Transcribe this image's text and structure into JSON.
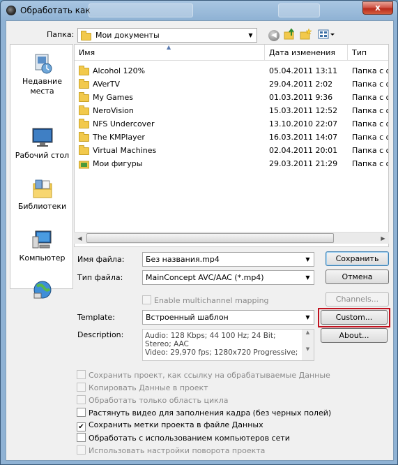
{
  "window": {
    "title": "Обработать как",
    "close": "x"
  },
  "look_in": {
    "label": "Папка:",
    "value": "Мои документы"
  },
  "places": [
    {
      "label": "Недавние места"
    },
    {
      "label": "Рабочий стол"
    },
    {
      "label": "Библиотеки"
    },
    {
      "label": "Компьютер"
    },
    {
      "label": ""
    }
  ],
  "columns": {
    "name": "Имя",
    "date": "Дата изменения",
    "type": "Тип"
  },
  "files": [
    {
      "name": "Alcohol 120%",
      "date": "05.04.2011 13:11",
      "type": "Папка с ф"
    },
    {
      "name": "AVerTV",
      "date": "29.04.2011 2:02",
      "type": "Папка с ф"
    },
    {
      "name": "My Games",
      "date": "01.03.2011 9:36",
      "type": "Папка с ф"
    },
    {
      "name": "NeroVision",
      "date": "15.03.2011 12:52",
      "type": "Папка с ф"
    },
    {
      "name": "NFS Undercover",
      "date": "13.10.2010 22:07",
      "type": "Папка с ф"
    },
    {
      "name": "The KMPlayer",
      "date": "16.03.2011 14:07",
      "type": "Папка с ф"
    },
    {
      "name": "Virtual Machines",
      "date": "02.04.2011 20:01",
      "type": "Папка с ф"
    },
    {
      "name": "Мои фигуры",
      "date": "29.03.2011 21:29",
      "type": "Папка с ф"
    }
  ],
  "filename": {
    "label": "Имя файла:",
    "value": "Без названия.mp4"
  },
  "filetype": {
    "label": "Тип файла:",
    "value": "MainConcept AVC/AAC (*.mp4)"
  },
  "multichannel": {
    "label": "Enable multichannel mapping"
  },
  "template": {
    "label": "Template:",
    "value": "Встроенный шаблон"
  },
  "description": {
    "label": "Description:",
    "text": "Audio: 128 Kbps; 44 100 Hz; 24 Bit; Stereo; AAC\nVideo: 29,970 fps; 1280x720 Progressive;"
  },
  "buttons": {
    "save": "Сохранить",
    "cancel": "Отмена",
    "channels": "Channels...",
    "custom": "Custom...",
    "about": "About..."
  },
  "options": [
    {
      "label": "Сохранить проект, как ссылку на обрабатываемые Данные",
      "checked": false,
      "enabled": false
    },
    {
      "label": "Копировать Данные в проект",
      "checked": false,
      "enabled": false
    },
    {
      "label": "Обработать только область цикла",
      "checked": false,
      "enabled": false
    },
    {
      "label": "Растянуть видео для заполнения кадра (без черных полей)",
      "checked": false,
      "enabled": true
    },
    {
      "label": "Сохранить метки проекта в файле Данных",
      "checked": true,
      "enabled": true
    },
    {
      "label": "Обработать с использованием компьютеров сети",
      "checked": false,
      "enabled": true
    },
    {
      "label": "Использовать настройки поворота проекта",
      "checked": false,
      "enabled": false
    }
  ],
  "colors": {
    "highlight": "#c0121f",
    "folder": "#f2c94c",
    "titlebar": "#a9c6e2"
  },
  "icons": [
    "back-arrow-icon",
    "up-folder-icon",
    "new-folder-icon",
    "view-menu-icon",
    "recent-places-icon",
    "desktop-icon",
    "libraries-icon",
    "computer-icon",
    "network-icon"
  ]
}
